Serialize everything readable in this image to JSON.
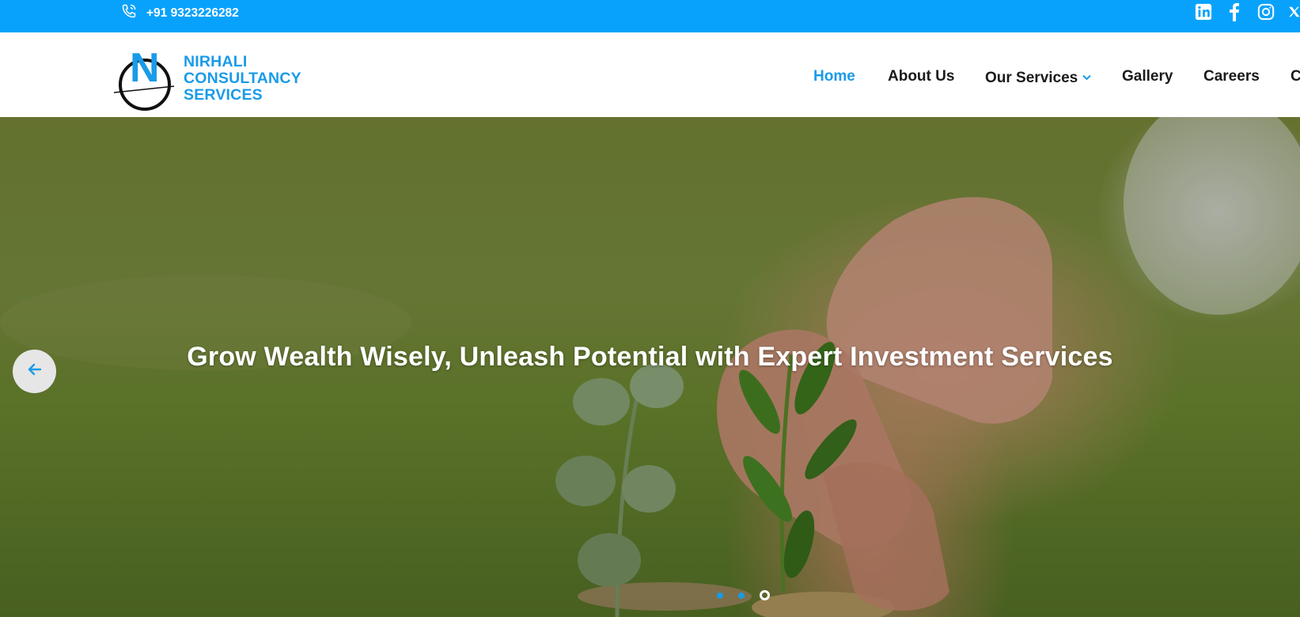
{
  "topbar": {
    "phone": "+91 9323226282",
    "phone_icon": "phone-icon",
    "social": [
      "linkedin-icon",
      "facebook-icon",
      "instagram-icon",
      "x-icon"
    ],
    "background": "#08a2fc"
  },
  "logo": {
    "letter": "N",
    "line1": "NIRHALI",
    "line2": "CONSULTANCY",
    "line3": "SERVICES",
    "color": "#1a9be8"
  },
  "nav": {
    "home": "Home",
    "about": "About Us",
    "services": "Our Services",
    "gallery": "Gallery",
    "careers": "Careers",
    "contact": "C",
    "active_color": "#1a9be8"
  },
  "hero": {
    "title": "Grow Wealth Wisely, Unleash Potential with Expert Investment Services",
    "prev_icon": "arrow-left-icon",
    "slides": 3,
    "current_slide": 3
  }
}
